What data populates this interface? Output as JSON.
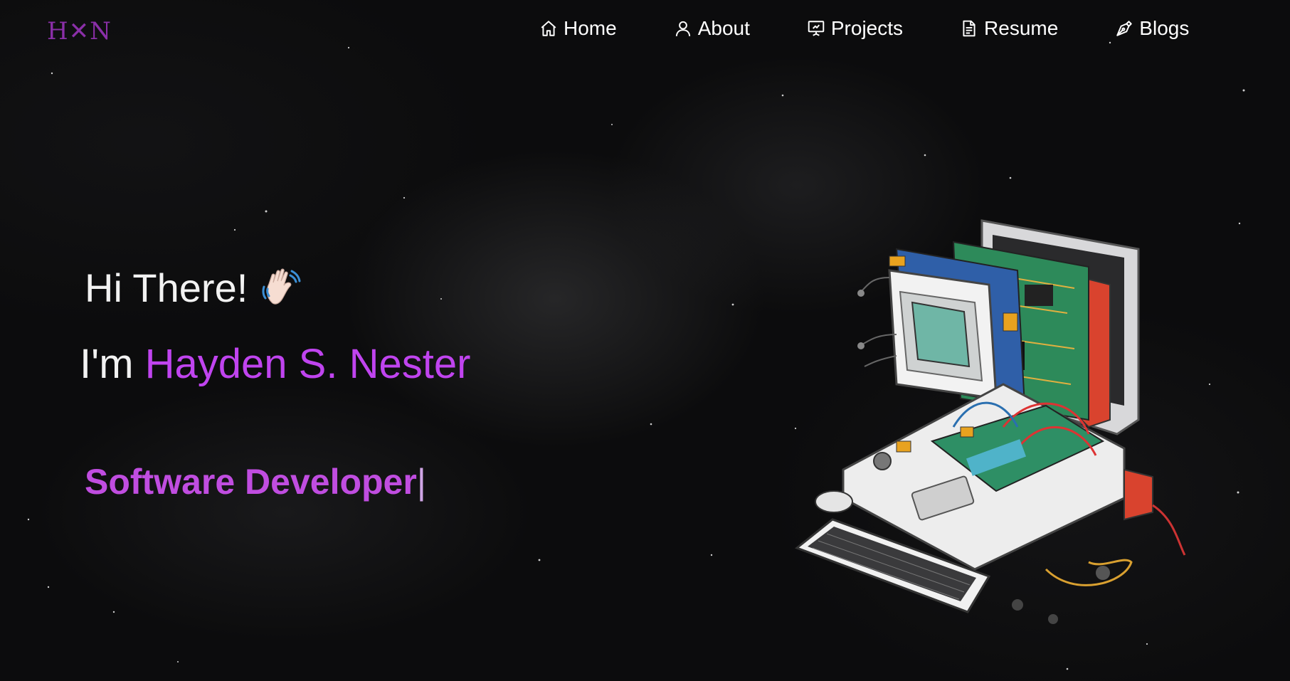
{
  "logo": {
    "text": "H✕N"
  },
  "nav": {
    "items": [
      {
        "label": "Home",
        "icon": "home-icon"
      },
      {
        "label": "About",
        "icon": "user-icon"
      },
      {
        "label": "Projects",
        "icon": "presentation-icon"
      },
      {
        "label": "Resume",
        "icon": "document-icon"
      },
      {
        "label": "Blogs",
        "icon": "pen-nib-icon"
      }
    ]
  },
  "hero": {
    "greeting": "Hi There!",
    "intro_prefix": "I'm ",
    "name": "Hayden S. Nester",
    "role": "Software Developer",
    "cursor": "|"
  },
  "colors": {
    "accent": "#c044ef",
    "role": "#c04de0",
    "logo": "#8a2fa8",
    "background": "#0c0c0d"
  }
}
